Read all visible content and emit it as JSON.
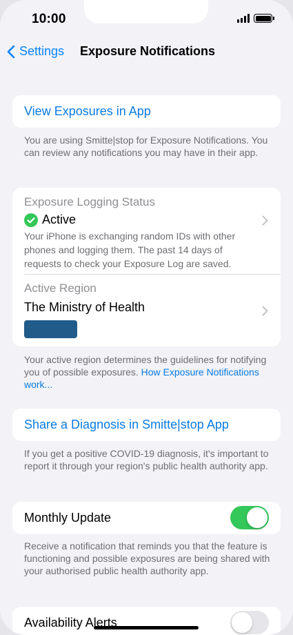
{
  "status_bar": {
    "time": "10:00"
  },
  "nav": {
    "back_label": "Settings",
    "title": "Exposure Notifications"
  },
  "view_exposures": {
    "label": "View Exposures in App",
    "footnote": "You are using Smitte|stop for Exposure Notifications. You can review any notifications you may have in their app."
  },
  "logging": {
    "label": "Exposure Logging Status",
    "status": "Active",
    "description": "Your iPhone is exchanging random IDs with other phones and logging them. The past 14 days of requests to check your Exposure Log are saved."
  },
  "region": {
    "label": "Active Region",
    "name": "The Ministry of Health",
    "logo_color": "#215b8a",
    "footnote_text": "Your active region determines the guidelines for notifying you of possible exposures. ",
    "footnote_link": "How Exposure Notifications work..."
  },
  "share_diagnosis": {
    "label": "Share a Diagnosis in Smitte|stop App",
    "footnote": "If you get a positive COVID-19 diagnosis, it's important to report it through your region's public health authority app."
  },
  "monthly_update": {
    "label": "Monthly Update",
    "enabled": true,
    "footnote": "Receive a notification that reminds you that the feature is functioning and possible exposures are being shared with your authorised public health authority app."
  },
  "availability_alerts": {
    "label": "Availability Alerts",
    "enabled": false
  },
  "colors": {
    "accent": "#0a7be0",
    "toggle_on": "#34c759",
    "toggle_off": "#e5e5ea",
    "check_green": "#34c759"
  }
}
